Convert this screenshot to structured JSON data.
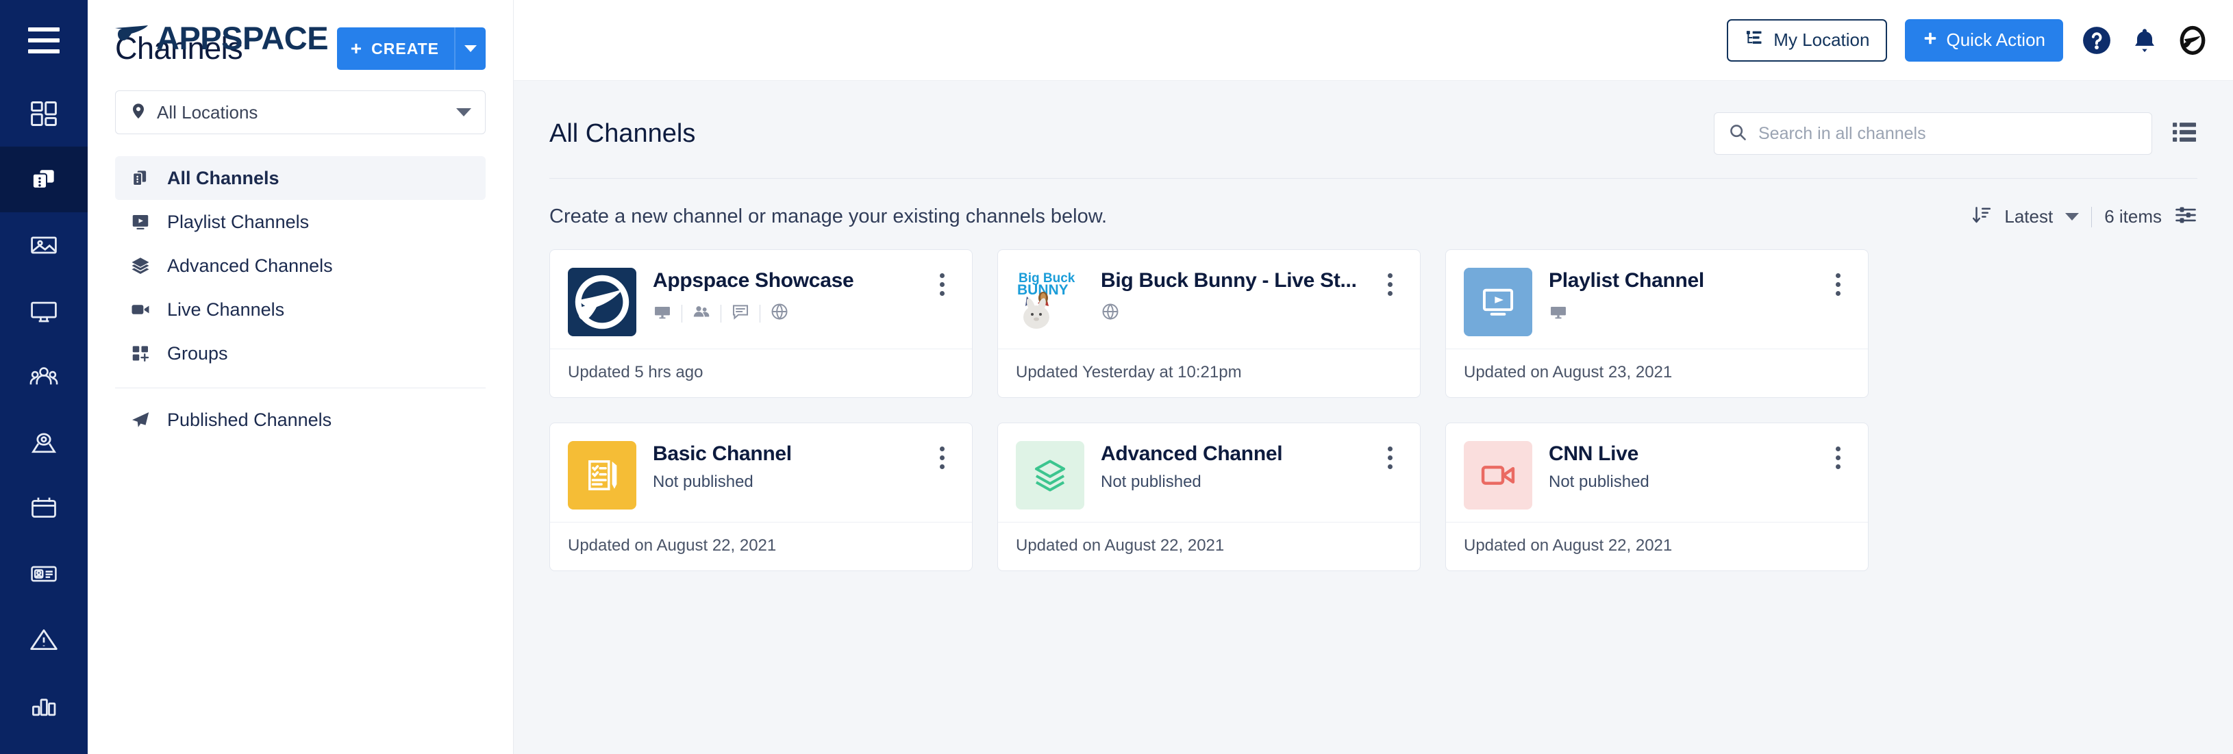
{
  "brand": {
    "logo_text": "APPSPACE",
    "accent_blue": "#2680eb",
    "navy": "#0a2463",
    "navy_dark": "#071a47"
  },
  "topbar": {
    "menu_icon": "hamburger-menu-icon",
    "my_location_label": "My Location",
    "my_location_icon": "location-hierarchy-icon",
    "quick_action_label": "Quick Action",
    "quick_action_icon": "plus-icon",
    "help_icon": "help-circle-icon",
    "notifications_icon": "bell-icon",
    "avatar_icon": "user-avatar-icon"
  },
  "rail": {
    "items": [
      {
        "icon": "dashboard-grid-icon",
        "active": false
      },
      {
        "icon": "channels-cards-icon",
        "active": true
      },
      {
        "icon": "image-media-icon",
        "active": false
      },
      {
        "icon": "display-monitor-icon",
        "active": false
      },
      {
        "icon": "users-group-icon",
        "active": false
      },
      {
        "icon": "location-pin-icon",
        "active": false
      },
      {
        "icon": "calendar-icon",
        "active": false
      },
      {
        "icon": "badge-card-icon",
        "active": false
      },
      {
        "icon": "alert-triangle-icon",
        "active": false
      },
      {
        "icon": "analytics-bar-icon",
        "active": false
      }
    ]
  },
  "panel": {
    "title": "Channels",
    "create_label": "CREATE",
    "create_plus": "+",
    "location_filter": {
      "icon": "location-pin-icon",
      "value": "All Locations"
    },
    "nav": [
      {
        "label": "All Channels",
        "icon": "channels-stack-icon",
        "active": true
      },
      {
        "label": "Playlist Channels",
        "icon": "playlist-play-icon",
        "active": false
      },
      {
        "label": "Advanced Channels",
        "icon": "layers-icon",
        "active": false
      },
      {
        "label": "Live Channels",
        "icon": "video-camera-icon",
        "active": false
      },
      {
        "label": "Groups",
        "icon": "groups-add-icon",
        "active": false
      }
    ],
    "nav_secondary": [
      {
        "label": "Published Channels",
        "icon": "send-paper-plane-icon",
        "active": false
      }
    ]
  },
  "main": {
    "page_title": "All Channels",
    "search": {
      "placeholder": "Search in all channels",
      "value": "",
      "icon": "search-icon"
    },
    "view_toggle_icon": "list-view-icon",
    "description": "Create a new channel or manage your existing channels below.",
    "sort": {
      "icon": "sort-descending-icon",
      "label": "Latest"
    },
    "items_count": "6 items",
    "filter_icon": "sliders-filter-icon"
  },
  "channels": [
    {
      "title": "Appspace Showcase",
      "subtitle": "",
      "updated": "Updated 5 hrs ago",
      "thumb_type": "appspace-logo",
      "thumb_bg": "#12335c",
      "meta_icons": [
        "display-monitor-icon",
        "users-group-icon",
        "comment-icon",
        "globe-icon"
      ]
    },
    {
      "title": "Big Buck Bunny - Live St...",
      "subtitle": "",
      "updated": "Updated Yesterday at 10:21pm",
      "thumb_type": "big-buck-bunny",
      "thumb_bg": "#ffffff",
      "meta_icons": [
        "globe-icon"
      ]
    },
    {
      "title": "Playlist Channel",
      "subtitle": "",
      "updated": "Updated on August 23, 2021",
      "thumb_type": "playlist",
      "thumb_bg": "#73aada",
      "meta_icons": [
        "display-monitor-icon"
      ]
    },
    {
      "title": "Basic Channel",
      "subtitle": "Not published",
      "updated": "Updated on August 22, 2021",
      "thumb_type": "basic",
      "thumb_bg": "#f5bd36",
      "meta_icons": []
    },
    {
      "title": "Advanced Channel",
      "subtitle": "Not published",
      "updated": "Updated on August 22, 2021",
      "thumb_type": "advanced",
      "thumb_bg": "#dff3e6",
      "meta_icons": []
    },
    {
      "title": "CNN Live",
      "subtitle": "Not published",
      "updated": "Updated on August 22, 2021",
      "thumb_type": "live",
      "thumb_bg": "#fadedd",
      "meta_icons": []
    }
  ]
}
